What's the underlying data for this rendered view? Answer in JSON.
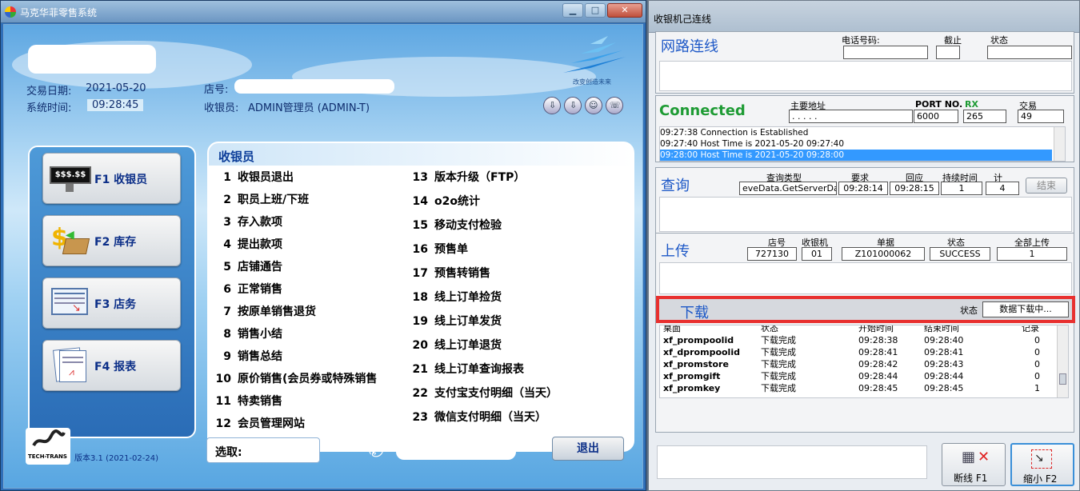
{
  "app": {
    "title": "马克华菲零售系统",
    "trade_date_label": "交易日期:",
    "trade_date": "2021-05-20",
    "system_time_label": "系统时间:",
    "system_time": "09:28:45",
    "store_label": "店号:",
    "cashier_label": "收银员:",
    "cashier_value": "ADMIN管理员 (ADMIN-T)",
    "logo_slogan": "改变创造未来",
    "version": "版本3.1 (2021-02-24)",
    "vendor": "TECH-TRANS"
  },
  "side_buttons": [
    {
      "label": "F1 收银员",
      "icon": "cash-register-icon",
      "icon_text": "$$$.$$"
    },
    {
      "label": "F2 库存",
      "icon": "inventory-icon"
    },
    {
      "label": "F3 店务",
      "icon": "store-affairs-icon"
    },
    {
      "label": "F4 报表",
      "icon": "report-icon"
    }
  ],
  "menu": {
    "header": "收银员",
    "left": [
      {
        "n": "1",
        "t": "收银员退出"
      },
      {
        "n": "2",
        "t": "职员上班/下班"
      },
      {
        "n": "3",
        "t": "存入款项"
      },
      {
        "n": "4",
        "t": "提出款项"
      },
      {
        "n": "5",
        "t": "店铺通告"
      },
      {
        "n": "6",
        "t": "正常销售"
      },
      {
        "n": "7",
        "t": "按原单销售退货"
      },
      {
        "n": "8",
        "t": "销售小结"
      },
      {
        "n": "9",
        "t": "销售总结"
      },
      {
        "n": "10",
        "t": "原价销售(会员券或特殊销售"
      },
      {
        "n": "11",
        "t": "特卖销售"
      },
      {
        "n": "12",
        "t": "会员管理网站"
      }
    ],
    "right": [
      {
        "n": "13",
        "t": "版本升级（FTP）"
      },
      {
        "n": "14",
        "t": "o2o统计"
      },
      {
        "n": "15",
        "t": "移动支付检验"
      },
      {
        "n": "16",
        "t": "预售单"
      },
      {
        "n": "17",
        "t": "预售转销售"
      },
      {
        "n": "18",
        "t": "线上订单捡货"
      },
      {
        "n": "19",
        "t": "线上订单发货"
      },
      {
        "n": "20",
        "t": "线上订单退货"
      },
      {
        "n": "21",
        "t": "线上订单查询报表"
      },
      {
        "n": "22",
        "t": "支付宝支付明细（当天）"
      },
      {
        "n": "23",
        "t": "微信支付明细（当天）"
      }
    ]
  },
  "select_label": "选取:",
  "exit_label": "退出",
  "pos": {
    "title": "收银机己连线",
    "network": {
      "title": "网路连线",
      "phone_label": "电话号码:",
      "cutoff_label": "截止",
      "status_label": "状态"
    },
    "connected": {
      "title": "Connected",
      "host_label": "主要地址",
      "host_value": ". . . . .",
      "port_label": "PORT NO.",
      "port_value": "6000",
      "rx_label": "RX",
      "rx_value": "265",
      "trade_label": "交易",
      "trade_value": "49",
      "log": [
        "09:27:38 Connection is Established",
        "09:27:40 Host Time is 2021-05-20 09:27:40",
        "09:28:00 Host Time is 2021-05-20 09:28:00"
      ]
    },
    "query": {
      "title": "查询",
      "type_label": "查询类型",
      "type_value": "eveData.GetServerDataB",
      "req_label": "要求",
      "req_value": "09:28:14",
      "resp_label": "回应",
      "resp_value": "09:28:15",
      "dur_label": "持续时间",
      "dur_value": "1",
      "count_label": "计",
      "count_value": "4",
      "end_label": "结束"
    },
    "upload": {
      "title": "上传",
      "store_label": "店号",
      "store_value": "727130",
      "pos_label": "收银机",
      "pos_value": "01",
      "doc_label": "单据",
      "doc_value": "Z101000062",
      "status_label": "状态",
      "status_value": "SUCCESS",
      "all_label": "全部上传",
      "all_value": "1"
    },
    "download": {
      "title": "下载",
      "status_label": "状态",
      "status_value": "数据下载中...",
      "columns": [
        "桌面",
        "状态",
        "开始时间",
        "结束时间",
        "记录"
      ],
      "rows": [
        [
          "xf_prompoolid",
          "下载完成",
          "09:28:38",
          "09:28:40",
          "0"
        ],
        [
          "xf_dprompoolid",
          "下载完成",
          "09:28:41",
          "09:28:41",
          "0"
        ],
        [
          "xf_promstore",
          "下载完成",
          "09:28:42",
          "09:28:43",
          "0"
        ],
        [
          "xf_promgift",
          "下载完成",
          "09:28:44",
          "09:28:44",
          "0"
        ],
        [
          "xf_promkey",
          "下载完成",
          "09:28:45",
          "09:28:45",
          "1"
        ]
      ]
    },
    "disconnect_label": "断线 F1",
    "minimize_label": "缩小 F2",
    "highlight_color": "#e8302f"
  }
}
